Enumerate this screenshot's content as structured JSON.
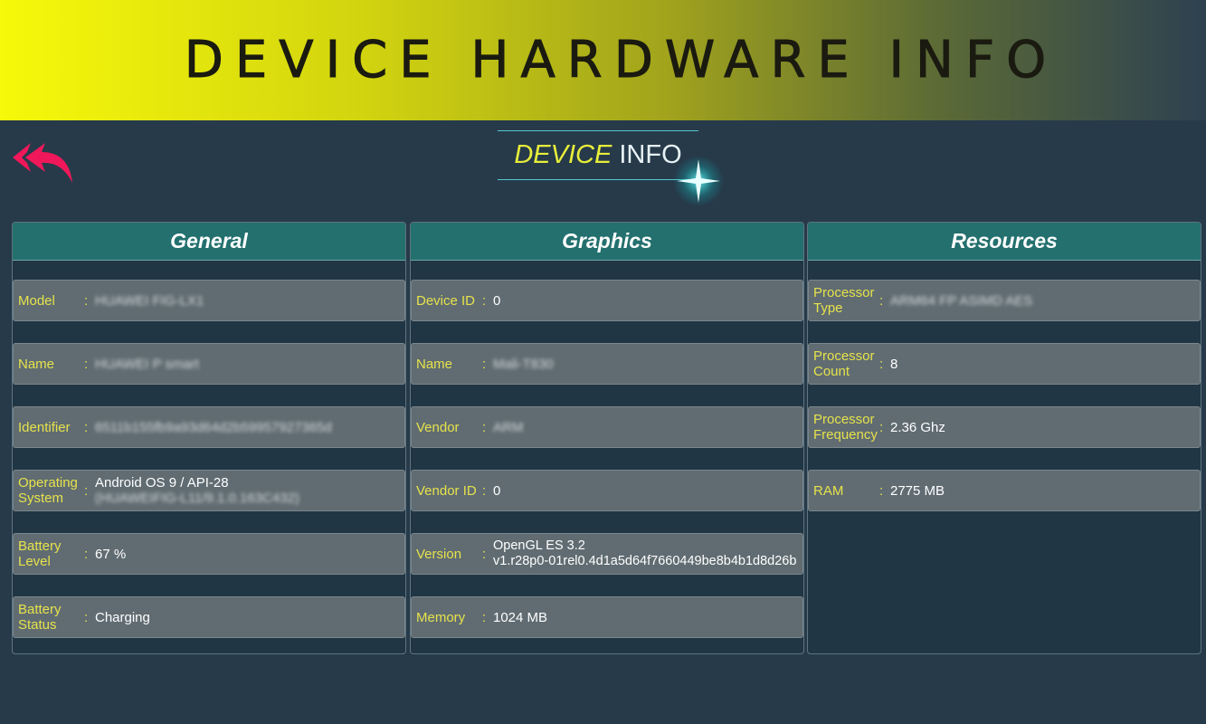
{
  "header": {
    "title": "DEVICE HARDWARE INFO"
  },
  "subtitle": {
    "part1": "DEVICE",
    "part2": "INFO"
  },
  "panels": {
    "general": {
      "title": "General",
      "rows": [
        {
          "label": "Model",
          "value": "HUAWEI FIG-LX1",
          "value2": ""
        },
        {
          "label": "Name",
          "value": "HUAWEI P smart",
          "value2": ""
        },
        {
          "label": "Identifier",
          "value": "6511b155fb9a93d64d2b59957927365d",
          "value2": ""
        },
        {
          "label": "Operating System",
          "value": "Android OS 9 / API-28",
          "value2": "(HUAWEIFIG-L11/9.1.0.163C432)"
        },
        {
          "label": "Battery Level",
          "value": "67 %",
          "value2": ""
        },
        {
          "label": "Battery Status",
          "value": "Charging",
          "value2": ""
        }
      ]
    },
    "graphics": {
      "title": "Graphics",
      "rows": [
        {
          "label": "Device ID",
          "value": "0",
          "value2": ""
        },
        {
          "label": "Name",
          "value": "Mali-T830",
          "value2": ""
        },
        {
          "label": "Vendor",
          "value": "ARM",
          "value2": ""
        },
        {
          "label": "Vendor ID",
          "value": "0",
          "value2": ""
        },
        {
          "label": "Version",
          "value": "OpenGL ES 3.2",
          "value2": "v1.r28p0-01rel0.4d1a5d64f7660449be8b4b1d8d26b"
        },
        {
          "label": "Memory",
          "value": "1024 MB",
          "value2": ""
        }
      ]
    },
    "resources": {
      "title": "Resources",
      "rows": [
        {
          "label": "Processor Type",
          "value": "ARM64 FP ASIMD AES",
          "value2": ""
        },
        {
          "label": "Processor Count",
          "value": "8",
          "value2": ""
        },
        {
          "label": "Processor Frequency",
          "value": "2.36 Ghz",
          "value2": ""
        },
        {
          "label": "RAM",
          "value": "2775 MB",
          "value2": ""
        }
      ]
    }
  },
  "separator": ":",
  "icons": {
    "back": "double-back-arrow-icon",
    "sparkle": "sparkle-icon"
  },
  "colors": {
    "accent": "#23706f",
    "label": "#e6e24b",
    "back_arrow": "#f0185a"
  }
}
